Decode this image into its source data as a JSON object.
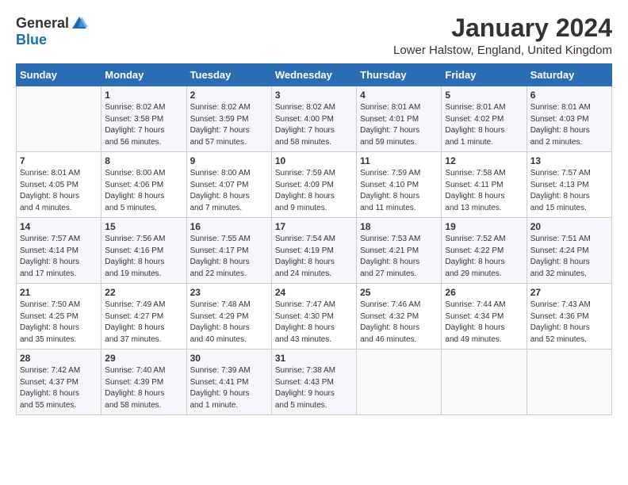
{
  "logo": {
    "general": "General",
    "blue": "Blue"
  },
  "header": {
    "title": "January 2024",
    "location": "Lower Halstow, England, United Kingdom"
  },
  "days_of_week": [
    "Sunday",
    "Monday",
    "Tuesday",
    "Wednesday",
    "Thursday",
    "Friday",
    "Saturday"
  ],
  "weeks": [
    [
      {
        "num": "",
        "info": ""
      },
      {
        "num": "1",
        "info": "Sunrise: 8:02 AM\nSunset: 3:58 PM\nDaylight: 7 hours\nand 56 minutes."
      },
      {
        "num": "2",
        "info": "Sunrise: 8:02 AM\nSunset: 3:59 PM\nDaylight: 7 hours\nand 57 minutes."
      },
      {
        "num": "3",
        "info": "Sunrise: 8:02 AM\nSunset: 4:00 PM\nDaylight: 7 hours\nand 58 minutes."
      },
      {
        "num": "4",
        "info": "Sunrise: 8:01 AM\nSunset: 4:01 PM\nDaylight: 7 hours\nand 59 minutes."
      },
      {
        "num": "5",
        "info": "Sunrise: 8:01 AM\nSunset: 4:02 PM\nDaylight: 8 hours\nand 1 minute."
      },
      {
        "num": "6",
        "info": "Sunrise: 8:01 AM\nSunset: 4:03 PM\nDaylight: 8 hours\nand 2 minutes."
      }
    ],
    [
      {
        "num": "7",
        "info": "Sunrise: 8:01 AM\nSunset: 4:05 PM\nDaylight: 8 hours\nand 4 minutes."
      },
      {
        "num": "8",
        "info": "Sunrise: 8:00 AM\nSunset: 4:06 PM\nDaylight: 8 hours\nand 5 minutes."
      },
      {
        "num": "9",
        "info": "Sunrise: 8:00 AM\nSunset: 4:07 PM\nDaylight: 8 hours\nand 7 minutes."
      },
      {
        "num": "10",
        "info": "Sunrise: 7:59 AM\nSunset: 4:09 PM\nDaylight: 8 hours\nand 9 minutes."
      },
      {
        "num": "11",
        "info": "Sunrise: 7:59 AM\nSunset: 4:10 PM\nDaylight: 8 hours\nand 11 minutes."
      },
      {
        "num": "12",
        "info": "Sunrise: 7:58 AM\nSunset: 4:11 PM\nDaylight: 8 hours\nand 13 minutes."
      },
      {
        "num": "13",
        "info": "Sunrise: 7:57 AM\nSunset: 4:13 PM\nDaylight: 8 hours\nand 15 minutes."
      }
    ],
    [
      {
        "num": "14",
        "info": "Sunrise: 7:57 AM\nSunset: 4:14 PM\nDaylight: 8 hours\nand 17 minutes."
      },
      {
        "num": "15",
        "info": "Sunrise: 7:56 AM\nSunset: 4:16 PM\nDaylight: 8 hours\nand 19 minutes."
      },
      {
        "num": "16",
        "info": "Sunrise: 7:55 AM\nSunset: 4:17 PM\nDaylight: 8 hours\nand 22 minutes."
      },
      {
        "num": "17",
        "info": "Sunrise: 7:54 AM\nSunset: 4:19 PM\nDaylight: 8 hours\nand 24 minutes."
      },
      {
        "num": "18",
        "info": "Sunrise: 7:53 AM\nSunset: 4:21 PM\nDaylight: 8 hours\nand 27 minutes."
      },
      {
        "num": "19",
        "info": "Sunrise: 7:52 AM\nSunset: 4:22 PM\nDaylight: 8 hours\nand 29 minutes."
      },
      {
        "num": "20",
        "info": "Sunrise: 7:51 AM\nSunset: 4:24 PM\nDaylight: 8 hours\nand 32 minutes."
      }
    ],
    [
      {
        "num": "21",
        "info": "Sunrise: 7:50 AM\nSunset: 4:25 PM\nDaylight: 8 hours\nand 35 minutes."
      },
      {
        "num": "22",
        "info": "Sunrise: 7:49 AM\nSunset: 4:27 PM\nDaylight: 8 hours\nand 37 minutes."
      },
      {
        "num": "23",
        "info": "Sunrise: 7:48 AM\nSunset: 4:29 PM\nDaylight: 8 hours\nand 40 minutes."
      },
      {
        "num": "24",
        "info": "Sunrise: 7:47 AM\nSunset: 4:30 PM\nDaylight: 8 hours\nand 43 minutes."
      },
      {
        "num": "25",
        "info": "Sunrise: 7:46 AM\nSunset: 4:32 PM\nDaylight: 8 hours\nand 46 minutes."
      },
      {
        "num": "26",
        "info": "Sunrise: 7:44 AM\nSunset: 4:34 PM\nDaylight: 8 hours\nand 49 minutes."
      },
      {
        "num": "27",
        "info": "Sunrise: 7:43 AM\nSunset: 4:36 PM\nDaylight: 8 hours\nand 52 minutes."
      }
    ],
    [
      {
        "num": "28",
        "info": "Sunrise: 7:42 AM\nSunset: 4:37 PM\nDaylight: 8 hours\nand 55 minutes."
      },
      {
        "num": "29",
        "info": "Sunrise: 7:40 AM\nSunset: 4:39 PM\nDaylight: 8 hours\nand 58 minutes."
      },
      {
        "num": "30",
        "info": "Sunrise: 7:39 AM\nSunset: 4:41 PM\nDaylight: 9 hours\nand 1 minute."
      },
      {
        "num": "31",
        "info": "Sunrise: 7:38 AM\nSunset: 4:43 PM\nDaylight: 9 hours\nand 5 minutes."
      },
      {
        "num": "",
        "info": ""
      },
      {
        "num": "",
        "info": ""
      },
      {
        "num": "",
        "info": ""
      }
    ]
  ]
}
